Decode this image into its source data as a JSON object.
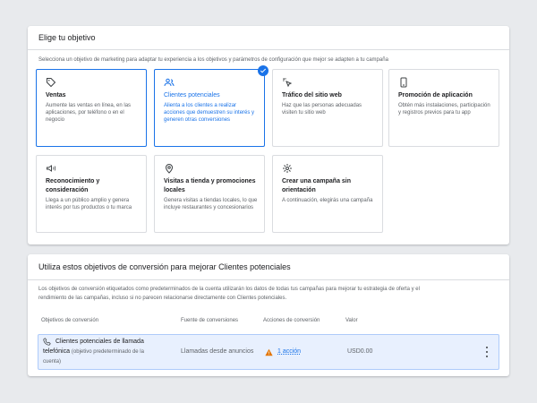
{
  "card1": {
    "title": "Elige tu objetivo",
    "description": "Selecciona un objetivo de marketing para adaptar tu experiencia a los objetivos y parámetros de configuración que mejor se adapten a tu campaña"
  },
  "goals": [
    {
      "title": "Ventas",
      "desc": "Aumente las ventas en línea, en las aplicaciones, por teléfono o en el negocio",
      "icon": "tag-icon"
    },
    {
      "title": "Clientes potenciales",
      "desc": "Alienta a los clientes a realizar acciones que demuestren su interés y generen otras conversiones",
      "icon": "people-icon",
      "selected": true
    },
    {
      "title": "Tráfico del sitio web",
      "desc": "Haz que las personas adecuadas visiten tu sitio web",
      "icon": "cursor-click-icon"
    },
    {
      "title": "Promoción de aplicación",
      "desc": "Obtén más instalaciones, participación y registros previos para tu app",
      "icon": "phone-icon"
    },
    {
      "title": "Reconocimiento y consideración",
      "desc": "Llega a un público amplio y genera interés por tus productos o tu marca",
      "icon": "megaphone-icon"
    },
    {
      "title": "Visitas a tienda y promociones locales",
      "desc": "Genera visitas a tiendas locales, lo que incluye restaurantes y concesionarios",
      "icon": "location-pin-icon"
    },
    {
      "title": "Crear una campaña sin orientación",
      "desc": "A continuación, elegirás una campaña",
      "icon": "gear-icon"
    }
  ],
  "card2": {
    "title": "Utiliza estos objetivos de conversión para mejorar Clientes potenciales",
    "desc_line1": "Los objetivos de conversión etiquetados como predeterminados de la cuenta utilizarán los datos de todas tus campañas para mejorar tu estrategia de oferta y el",
    "desc_line2": "rendimiento de las campañas, incluso si no parecen relacionarse directamente con Clientes potenciales."
  },
  "table": {
    "headers": [
      "Objetivos de conversión",
      "Fuente de conversiones",
      "Acciones de conversión",
      "Valor"
    ],
    "row": {
      "name_line1": "Clientes potenciales de llamada",
      "name_line2": "telefónica",
      "name_note": "(objetivo predeterminado de la",
      "name_note2": "cuenta)",
      "source": "Llamadas desde anuncios",
      "actions": "1 acción",
      "value": "USD0.00"
    }
  },
  "colors": {
    "accent": "#1a73e8",
    "warning": "#e37400",
    "selected_bg": "#e8f0fe"
  }
}
